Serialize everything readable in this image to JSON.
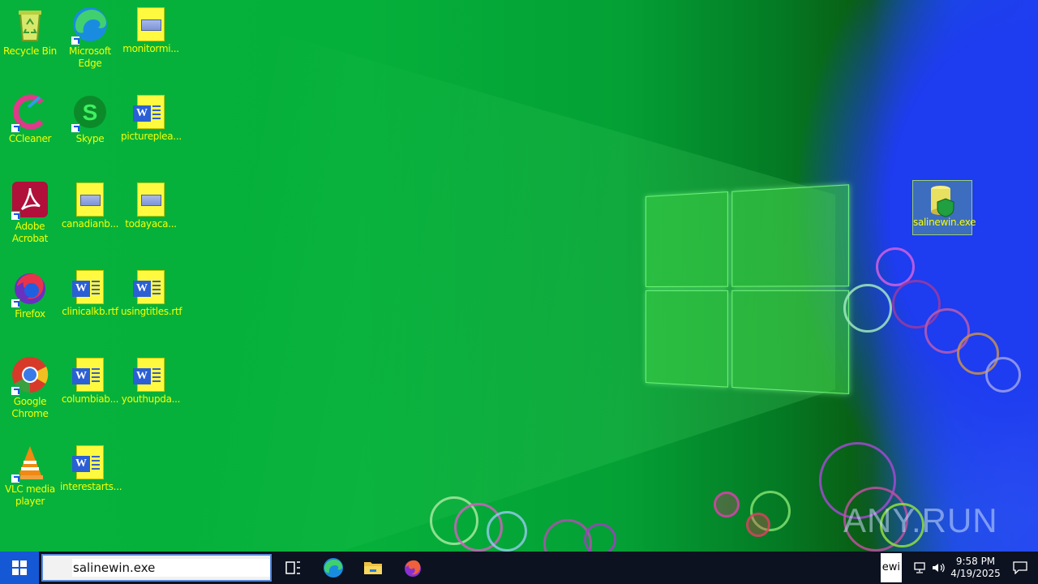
{
  "desktop": {
    "icons": [
      {
        "label": "Recycle Bin",
        "icon": "recycle-bin-icon"
      },
      {
        "label": "Microsoft Edge",
        "icon": "edge-icon"
      },
      {
        "label": "monitormi...",
        "icon": "image-file-icon"
      },
      {
        "label": "CCleaner",
        "icon": "ccleaner-icon"
      },
      {
        "label": "Skype",
        "icon": "skype-icon"
      },
      {
        "label": "pictureplea...",
        "icon": "word-document-icon"
      },
      {
        "label": "Adobe Acrobat",
        "icon": "acrobat-icon"
      },
      {
        "label": "canadianb...",
        "icon": "image-file-icon"
      },
      {
        "label": "todayaca...",
        "icon": "image-file-icon"
      },
      {
        "label": "Firefox",
        "icon": "firefox-icon"
      },
      {
        "label": "clinicalkb.rtf",
        "icon": "word-document-icon"
      },
      {
        "label": "usingtitles.rtf",
        "icon": "word-document-icon"
      },
      {
        "label": "Google Chrome",
        "icon": "chrome-icon"
      },
      {
        "label": "columbiab...",
        "icon": "word-document-icon"
      },
      {
        "label": "youthupda...",
        "icon": "word-document-icon"
      },
      {
        "label": "VLC media player",
        "icon": "vlc-icon"
      },
      {
        "label": "interestarts...",
        "icon": "word-document-icon"
      },
      {
        "label": "salinewin.exe",
        "icon": "salinewin-exe-icon"
      }
    ],
    "watermark": "ANY.RUN"
  },
  "taskbar": {
    "search_value": "salinewin.exe",
    "tray_snippet": "ewi",
    "clock_time": "9:58 PM",
    "clock_date": "4/19/2025"
  },
  "colors": {
    "label_color": "#f6ff00",
    "taskbar_bg": "#0c1220",
    "start_bg": "#1558d6"
  }
}
